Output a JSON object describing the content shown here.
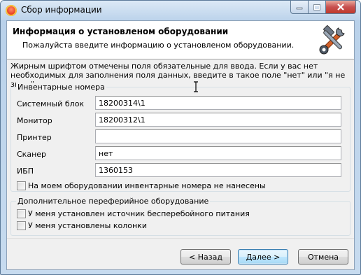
{
  "window": {
    "title": "Сбор информации"
  },
  "header": {
    "title": "Информация о установленом оборудовании",
    "subtitle": "Пожалуйста введите информацию о установленом оборудовании.",
    "icon": "tools-icon"
  },
  "intro_text": "Жирным шрифтом отмечены поля обязательные для ввода. Если у вас нет необходимых для заполнения поля данных, введите в такое поле \"нет\" или \"я не знаю\".",
  "inventory": {
    "legend": "Инвентарные номера",
    "fields": [
      {
        "label": "Системный блок",
        "value": "18200314\\1"
      },
      {
        "label": "Монитор",
        "value": "18200312\\1"
      },
      {
        "label": "Принтер",
        "value": ""
      },
      {
        "label": "Сканер",
        "value": "нет"
      },
      {
        "label": "ИБП",
        "value": "1360153"
      }
    ],
    "no_numbers_checkbox": {
      "label": "На моем оборудовании инвентарные номера не нанесены",
      "checked": false
    }
  },
  "peripherals": {
    "legend": "Дополнительное переферийное оборудование",
    "checkboxes": [
      {
        "label": "У меня установлен источник бесперебойного питания",
        "checked": false
      },
      {
        "label": "У меня установлены колонки",
        "checked": false
      }
    ]
  },
  "buttons": {
    "back": "< Назад",
    "next": "Далее >",
    "cancel": "Отмена"
  }
}
